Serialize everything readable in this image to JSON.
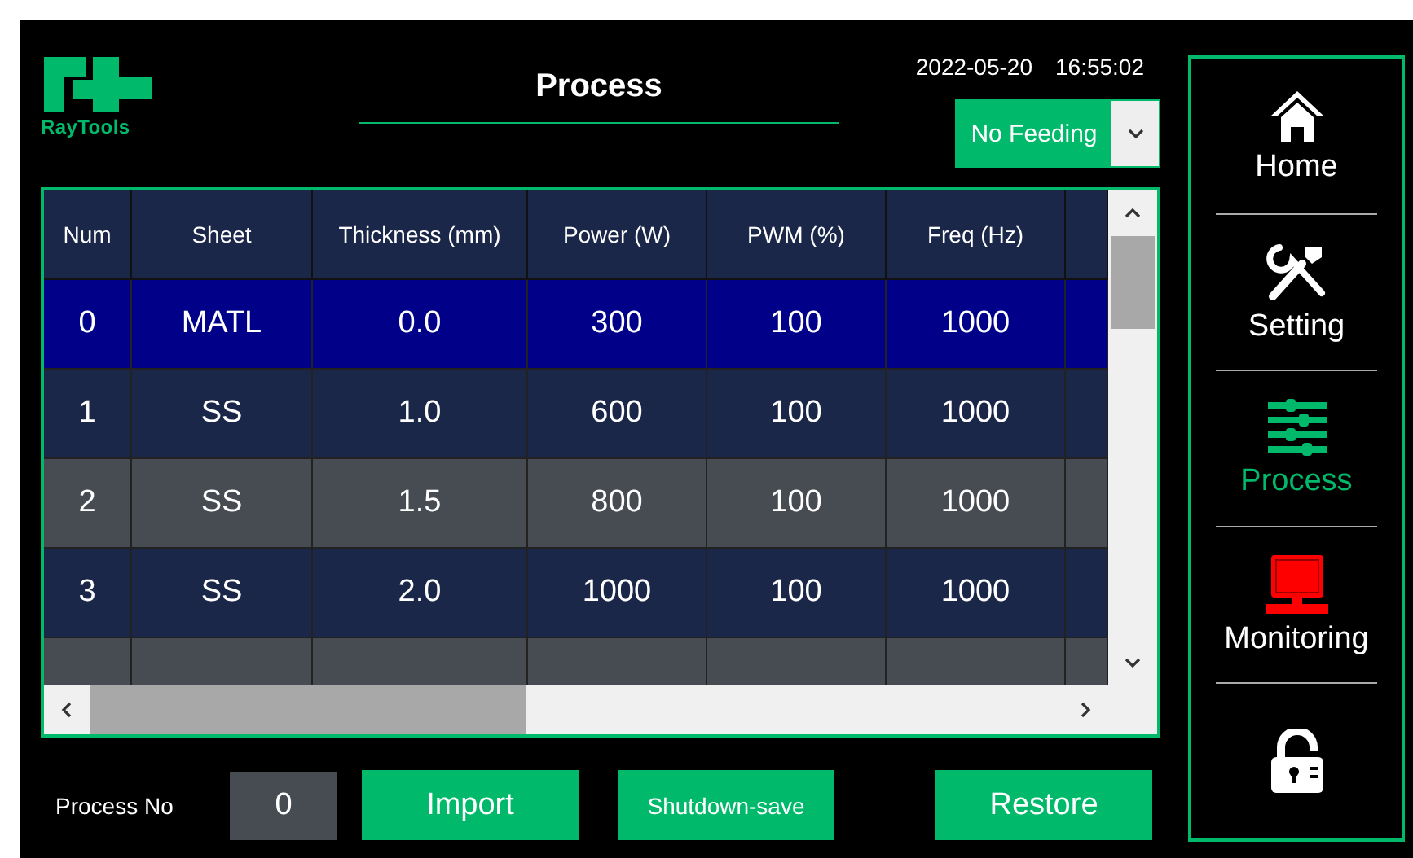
{
  "header": {
    "logo_text": "RayTools",
    "title": "Process",
    "date": "2022-05-20",
    "time": "16:55:02",
    "feeding": {
      "value": "No Feeding"
    }
  },
  "table": {
    "columns": [
      "Num",
      "Sheet",
      "Thickness (mm)",
      "Power (W)",
      "PWM (%)",
      "Freq (Hz)"
    ],
    "rows": [
      {
        "cells": [
          "0",
          "MATL",
          "0.0",
          "300",
          "100",
          "1000"
        ],
        "selected": true
      },
      {
        "cells": [
          "1",
          "SS",
          "1.0",
          "600",
          "100",
          "1000"
        ],
        "selected": false
      },
      {
        "cells": [
          "2",
          "SS",
          "1.5",
          "800",
          "100",
          "1000"
        ],
        "selected": false
      },
      {
        "cells": [
          "3",
          "SS",
          "2.0",
          "1000",
          "100",
          "1000"
        ],
        "selected": false
      }
    ]
  },
  "footer": {
    "process_no_label": "Process No",
    "process_no": "0",
    "buttons": [
      "Import",
      "Shutdown-save",
      "Restore"
    ]
  },
  "sidebar": {
    "items": [
      {
        "kind": "home",
        "label": "Home",
        "selected": false
      },
      {
        "kind": "setting",
        "label": "Setting",
        "selected": false
      },
      {
        "kind": "process",
        "label": "Process",
        "selected": true
      },
      {
        "kind": "monitoring",
        "label": "Monitoring",
        "selected": false,
        "alarm": true
      },
      {
        "kind": "lock",
        "locked": false
      }
    ]
  }
}
